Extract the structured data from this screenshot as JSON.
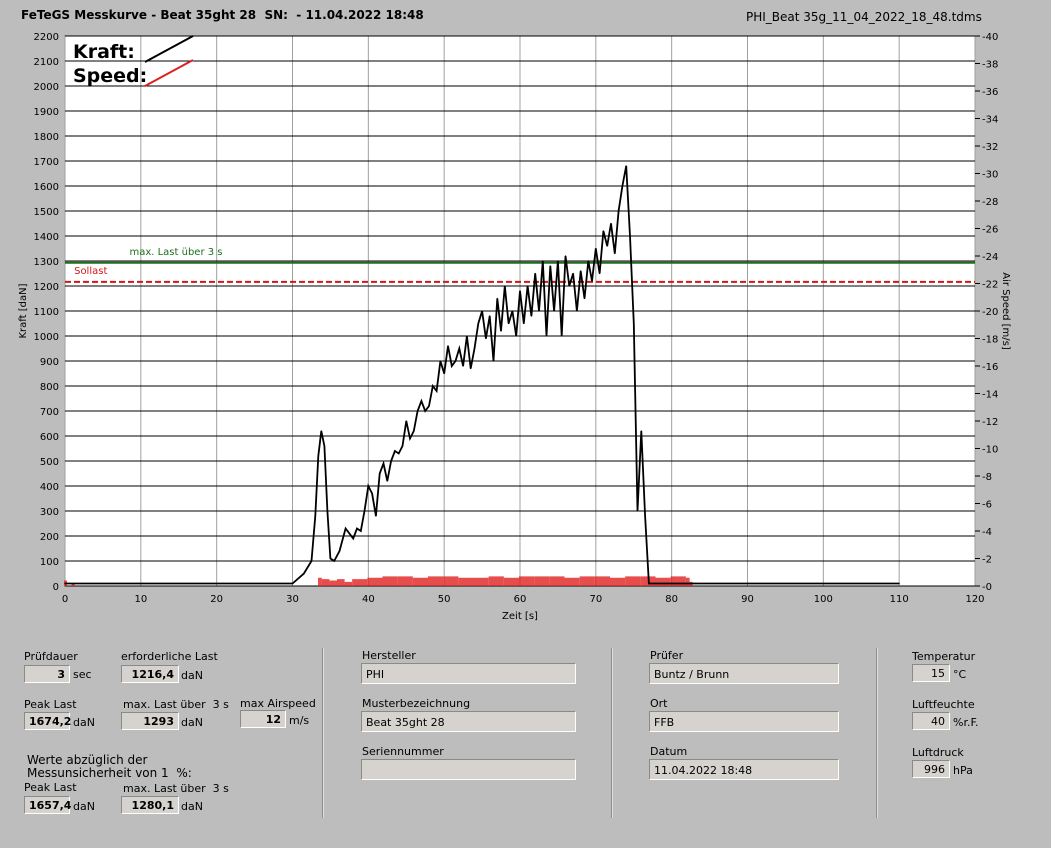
{
  "header": {
    "title": "FeTeGS Messkurve - Beat 35ght 28  SN:  - 11.04.2022 18:48",
    "file": "PHI_Beat 35g_11_04_2022_18_48.tdms"
  },
  "chart_data": {
    "type": "line",
    "xlabel": "Zeit [s]",
    "ylabel": "Kraft [daN]",
    "y2label": "Air Speed [m/s]",
    "xlim": [
      0,
      120
    ],
    "ylim": [
      0,
      2200
    ],
    "y2lim": [
      0,
      40
    ],
    "x_ticks": [
      "0",
      "10",
      "20",
      "30",
      "40",
      "50",
      "60",
      "70",
      "80",
      "90",
      "100",
      "110",
      "120"
    ],
    "y_ticks": [
      "0",
      "100",
      "200",
      "300",
      "400",
      "500",
      "600",
      "700",
      "800",
      "900",
      "1000",
      "1100",
      "1200",
      "1300",
      "1400",
      "1500",
      "1600",
      "1700",
      "1800",
      "1900",
      "2000",
      "2100",
      "2200"
    ],
    "y2_ticks": [
      "0",
      "2",
      "4",
      "6",
      "8",
      "10",
      "12",
      "14",
      "16",
      "18",
      "20",
      "22",
      "24",
      "26",
      "28",
      "30",
      "32",
      "34",
      "36",
      "38",
      "40"
    ],
    "legend": [
      {
        "label": "Kraft:",
        "color": "#000000"
      },
      {
        "label": "Speed:",
        "color": "#e02020"
      }
    ],
    "reference_lines": [
      {
        "label": "max. Last über  3 s",
        "value": 1293,
        "color": "#1e6e1e",
        "style": "solid"
      },
      {
        "label": "Sollast",
        "value": 1216.4,
        "color": "#d01818",
        "style": "dashed"
      }
    ],
    "series": [
      {
        "name": "Kraft",
        "color": "#000000",
        "x": [
          0,
          30,
          31.5,
          32.5,
          33,
          33.4,
          33.8,
          34.2,
          34.6,
          35,
          35.5,
          36.2,
          37,
          37.5,
          38,
          38.5,
          39,
          39.5,
          40,
          40.5,
          41,
          41.5,
          42,
          42.5,
          43,
          43.5,
          44,
          44.5,
          45,
          45.5,
          46,
          46.5,
          47,
          47.5,
          48,
          48.5,
          49,
          49.5,
          50,
          50.5,
          51,
          51.5,
          52,
          52.5,
          53,
          53.5,
          54,
          54.5,
          55,
          55.5,
          56,
          56.5,
          57,
          57.5,
          58,
          58.5,
          59,
          59.5,
          60,
          60.5,
          61,
          61.5,
          62,
          62.5,
          63,
          63.5,
          64,
          64.5,
          65,
          65.5,
          66,
          66.5,
          67,
          67.5,
          68,
          68.5,
          69,
          69.5,
          70,
          70.5,
          71,
          71.5,
          72,
          72.5,
          73,
          73.5,
          74,
          74.5,
          75,
          75.5,
          76,
          76.5,
          77,
          77.5,
          78,
          78.5,
          79,
          79.5,
          80,
          80.5,
          81,
          81.4,
          81.6,
          81.8,
          82,
          82.3,
          82.6,
          82.9,
          83.2,
          83.5,
          90,
          100,
          110
        ],
        "y": [
          10,
          10,
          50,
          100,
          280,
          520,
          620,
          560,
          300,
          110,
          100,
          140,
          230,
          210,
          190,
          230,
          220,
          300,
          400,
          370,
          280,
          450,
          490,
          420,
          500,
          540,
          530,
          560,
          660,
          590,
          620,
          700,
          740,
          700,
          720,
          800,
          780,
          900,
          850,
          960,
          880,
          900,
          950,
          880,
          1000,
          870,
          950,
          1050,
          1100,
          990,
          1080,
          900,
          1150,
          1020,
          1200,
          1050,
          1100,
          1000,
          1180,
          1050,
          1200,
          1080,
          1250,
          1100,
          1300,
          1000,
          1280,
          1100,
          1300,
          1000,
          1320,
          1200,
          1250,
          1100,
          1260,
          1150,
          1300,
          1220,
          1350,
          1250,
          1420,
          1360,
          1450,
          1330,
          1500,
          1600,
          1680,
          1400,
          1050,
          300,
          620,
          280,
          10,
          10,
          10,
          10,
          10,
          10,
          10,
          10,
          10,
          10,
          10,
          10,
          10,
          10,
          10,
          10,
          10,
          10,
          10,
          10,
          10
        ]
      },
      {
        "name": "Speed",
        "color": "#e02020",
        "note_type": "bars",
        "x": [
          0,
          1,
          33.5,
          34,
          35,
          36,
          37,
          38,
          40,
          42,
          44,
          46,
          48,
          50,
          52,
          54,
          56,
          58,
          60,
          62,
          64,
          66,
          68,
          70,
          72,
          74,
          76,
          78,
          80,
          82,
          82.5
        ],
        "y": [
          0.4,
          0.2,
          0.6,
          0.5,
          0.4,
          0.5,
          0.3,
          0.5,
          0.6,
          0.7,
          0.7,
          0.6,
          0.7,
          0.7,
          0.6,
          0.6,
          0.7,
          0.6,
          0.7,
          0.7,
          0.7,
          0.6,
          0.7,
          0.7,
          0.6,
          0.7,
          0.7,
          0.6,
          0.7,
          0.6,
          0.3
        ]
      }
    ]
  },
  "panel": {
    "pruefdauer_label": "Prüfdauer",
    "pruefdauer_value": "3",
    "pruefdauer_unit": "sec",
    "erf_last_label": "erforderliche Last",
    "erf_last_value": "1216,4",
    "erf_last_unit": "daN",
    "peak_label": "Peak Last",
    "peak_value": "1674,2",
    "peak_unit": "daN",
    "maxlast_label": "max. Last über  3 s",
    "maxlast_value": "1293",
    "maxlast_unit": "daN",
    "airspeed_label": "max Airspeed",
    "airspeed_value": "12",
    "airspeed_unit": "m/s",
    "werte_label": "Werte abzüglich der\nMessunsicherheit von 1  %:",
    "peak2_label": "Peak Last",
    "peak2_value": "1657,4",
    "peak2_unit": "daN",
    "maxlast2_label": "max. Last über  3 s",
    "maxlast2_value": "1280,1",
    "maxlast2_unit": "daN",
    "hersteller_label": "Hersteller",
    "hersteller_value": "PHI",
    "muster_label": "Musterbezeichnung",
    "muster_value": "Beat 35ght 28",
    "serien_label": "Seriennummer",
    "serien_value": "",
    "pruefer_label": "Prüfer",
    "pruefer_value": "Buntz / Brunn",
    "ort_label": "Ort",
    "ort_value": "FFB",
    "datum_label": "Datum",
    "datum_value": "11.04.2022 18:48",
    "temp_label": "Temperatur",
    "temp_value": "15",
    "temp_unit": "°C",
    "feuchte_label": "Luftfeuchte",
    "feuchte_value": "40",
    "feuchte_unit": "%r.F.",
    "druck_label": "Luftdruck",
    "druck_value": "996",
    "druck_unit": "hPa"
  }
}
